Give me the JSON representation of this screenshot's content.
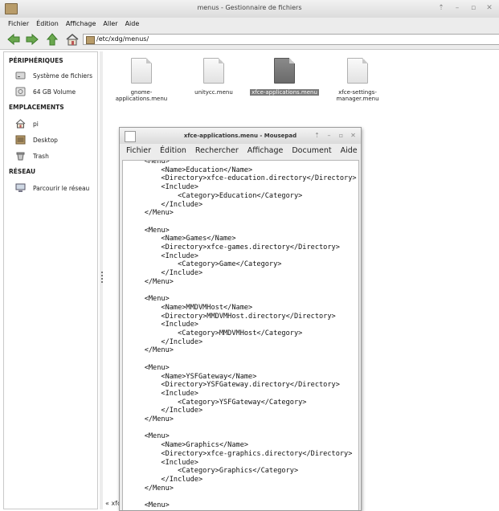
{
  "fm": {
    "title": "menus - Gestionnaire de fichiers",
    "menu": [
      "Fichier",
      "Édition",
      "Affichage",
      "Aller",
      "Aide"
    ],
    "location": "/etc/xdg/menus/",
    "status_fragment": "« xfc"
  },
  "sidebar": {
    "devices_header": "PÉRIPHÉRIQUES",
    "devices": [
      {
        "label": "Système de fichiers",
        "icon": "drive-icon"
      },
      {
        "label": "64 GB Volume",
        "icon": "removable-drive-icon"
      }
    ],
    "places_header": "EMPLACEMENTS",
    "places": [
      {
        "label": "pi",
        "icon": "home-folder-icon"
      },
      {
        "label": "Desktop",
        "icon": "desktop-icon"
      },
      {
        "label": "Trash",
        "icon": "trash-icon"
      }
    ],
    "network_header": "RÉSEAU",
    "network": [
      {
        "label": "Parcourir le réseau",
        "icon": "network-icon"
      }
    ]
  },
  "files": [
    {
      "name": "gnome-\napplications.menu",
      "selected": false
    },
    {
      "name": "unitycc.menu",
      "selected": false
    },
    {
      "name": "xfce-applications.menu",
      "selected": true
    },
    {
      "name": "xfce-settings-\nmanager.menu",
      "selected": false
    }
  ],
  "mousepad": {
    "title": "xfce-applications.menu - Mousepad",
    "menu": [
      "Fichier",
      "Édition",
      "Rechercher",
      "Affichage",
      "Document",
      "Aide"
    ],
    "lines": [
      "    <Menu>",
      "        <Name>Education</Name>",
      "        <Directory>xfce-education.directory</Directory>",
      "        <Include>",
      "            <Category>Education</Category>",
      "        </Include>",
      "    </Menu>",
      "",
      "    <Menu>",
      "        <Name>Games</Name>",
      "        <Directory>xfce-games.directory</Directory>",
      "        <Include>",
      "            <Category>Game</Category>",
      "        </Include>",
      "    </Menu>",
      "",
      "    <Menu>",
      "        <Name>MMDVMHost</Name>",
      "        <Directory>MMDVMHost.directory</Directory>",
      "        <Include>",
      "            <Category>MMDVMHost</Category>",
      "        </Include>",
      "    </Menu>",
      "",
      "    <Menu>",
      "        <Name>YSFGateway</Name>",
      "        <Directory>YSFGateway.directory</Directory>",
      "        <Include>",
      "            <Category>YSFGateway</Category>",
      "        </Include>",
      "    </Menu>",
      "",
      "    <Menu>",
      "        <Name>Graphics</Name>",
      "        <Directory>xfce-graphics.directory</Directory>",
      "        <Include>",
      "            <Category>Graphics</Category>",
      "        </Include>",
      "    </Menu>",
      "",
      "    <Menu>"
    ]
  }
}
